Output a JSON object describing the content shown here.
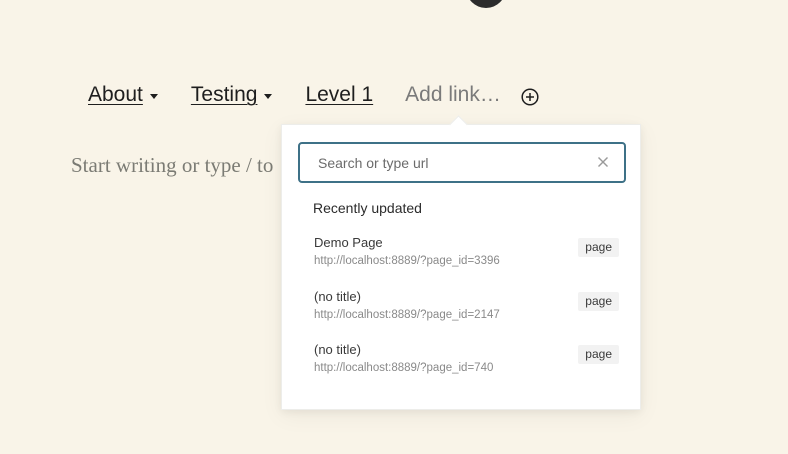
{
  "nav": {
    "items": [
      {
        "label": "About",
        "has_submenu": true
      },
      {
        "label": "Testing",
        "has_submenu": true
      },
      {
        "label": "Level 1",
        "has_submenu": false
      }
    ],
    "add_link_label": "Add link…"
  },
  "editor": {
    "placeholder": "Start writing or type / to"
  },
  "link_popover": {
    "search_placeholder": "Search or type url",
    "section_title": "Recently updated",
    "results": [
      {
        "title": "Demo Page",
        "url": "http://localhost:8889/?page_id=3396",
        "type": "page"
      },
      {
        "title": "(no title)",
        "url": "http://localhost:8889/?page_id=2147",
        "type": "page"
      },
      {
        "title": "(no title)",
        "url": "http://localhost:8889/?page_id=740",
        "type": "page"
      }
    ]
  },
  "colors": {
    "background": "#f9f4e8",
    "focus_border": "#3e7187",
    "text": "#1e1e1e",
    "muted": "#8a8a8a"
  },
  "icons": {
    "add": "plus-circle-icon",
    "clear": "close-icon",
    "submenu": "caret-down-icon"
  }
}
